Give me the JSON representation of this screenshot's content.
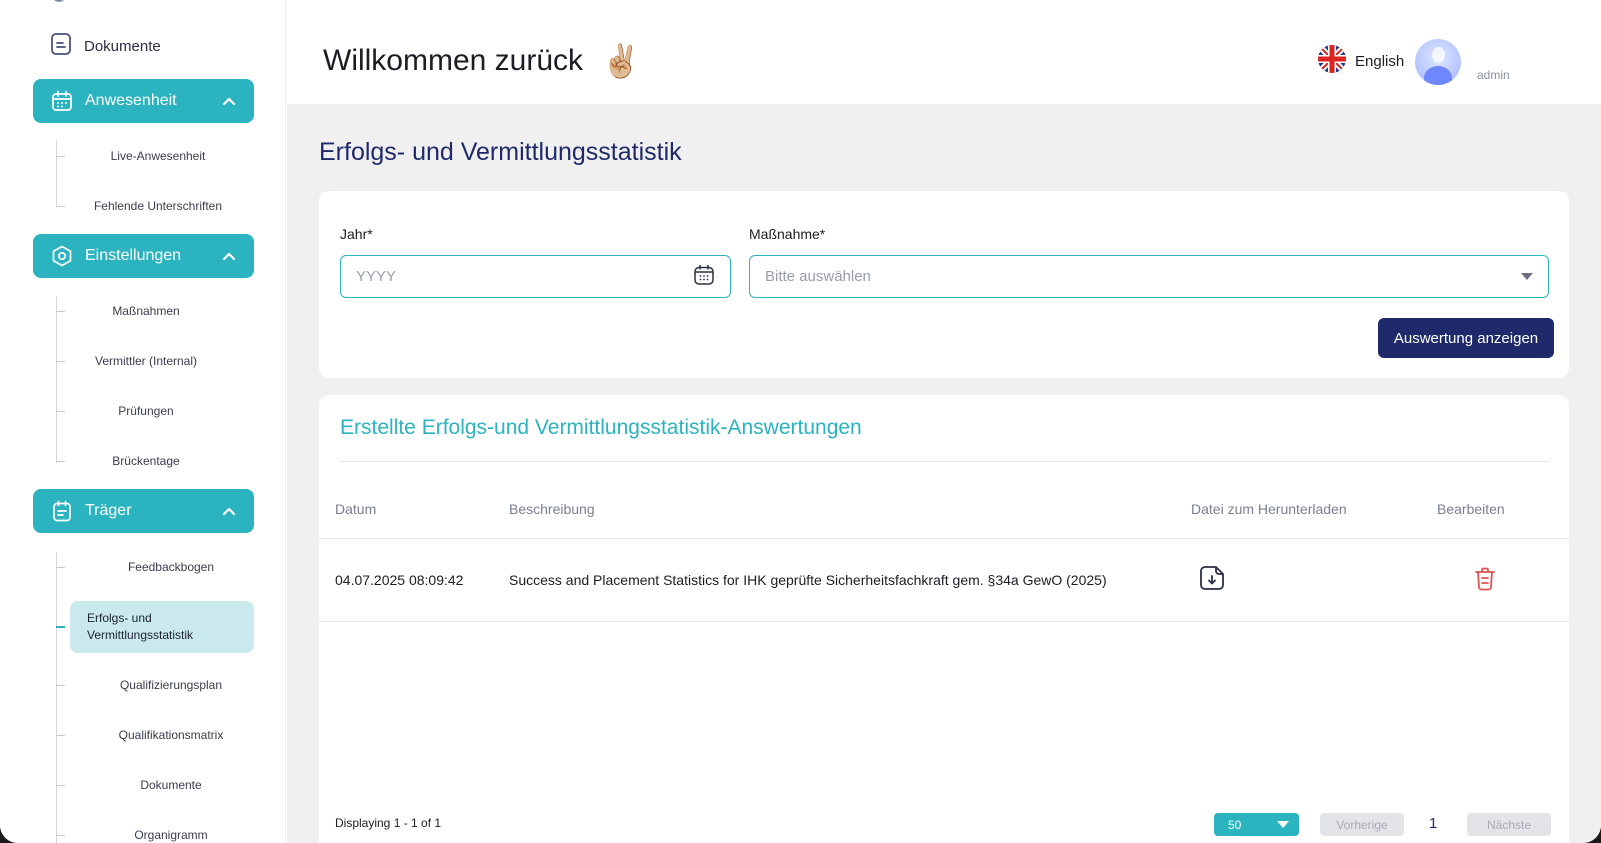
{
  "sidebar": {
    "documents_top": "Dokumente",
    "groups": [
      {
        "label": "Anwesenheit",
        "items": [
          "Live-Anwesenheit",
          "Fehlende Unterschriften"
        ]
      },
      {
        "label": "Einstellungen",
        "items": [
          "Maßnahmen",
          "Vermittler (Internal)",
          "Prüfungen",
          "Brückentage"
        ]
      },
      {
        "label": "Träger",
        "items": [
          "Feedbackbogen",
          "Erfolgs- und Vermittlungsstatistik",
          "Qualifizierungsplan",
          "Qualifikationsmatrix",
          "Dokumente",
          "Organigramm"
        ]
      }
    ],
    "active_line1": "Erfolgs- und",
    "active_line2": "Vermittlungsstatistik"
  },
  "header": {
    "welcome": "Willkommen zurück",
    "emoji": "✌🏼",
    "language": "English",
    "user": "admin"
  },
  "page": {
    "title": "Erfolgs- und Vermittlungsstatistik"
  },
  "form": {
    "year_label": "Jahr*",
    "year_placeholder": "YYYY",
    "measure_label": "Maßnahme*",
    "measure_placeholder": "Bitte auswählen",
    "submit": "Auswertung anzeigen"
  },
  "results": {
    "title": "Erstellte Erfolgs-und Vermittlungsstatistik-Answertungen",
    "columns": [
      "Datum",
      "Beschreibung",
      "Datei zum Herunterladen",
      "Bearbeiten"
    ],
    "rows": [
      {
        "date": "04.07.2025 08:09:42",
        "description": "Success and Placement Statistics for IHK geprüfte Sicherheitsfachkraft gem. §34a GewO (2025)"
      }
    ],
    "displaying": "Displaying 1 - 1 of 1",
    "page_size": "50",
    "prev": "Vorherige",
    "page": "1",
    "next": "Nächste"
  },
  "colors": {
    "teal": "#2bb3bf",
    "navy": "#1f2a6b",
    "active_bg": "#c9e9ec",
    "delete": "#e05252"
  }
}
